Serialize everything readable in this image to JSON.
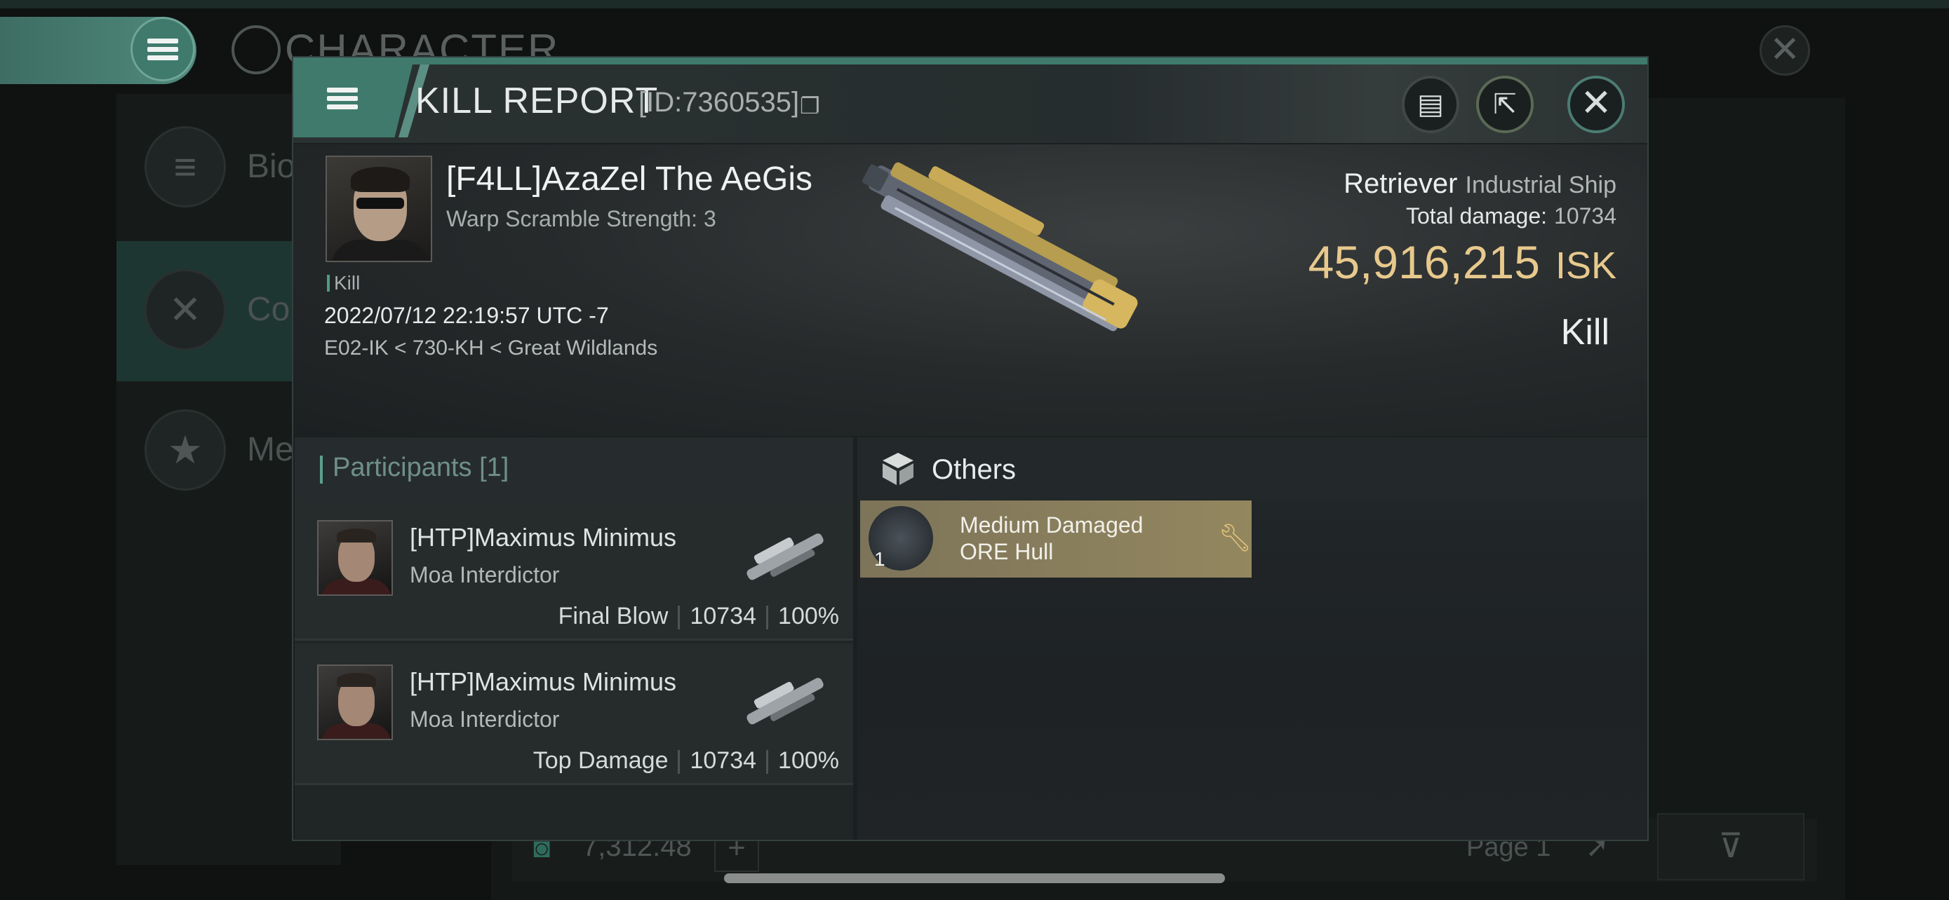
{
  "background": {
    "title": "CHARACTER",
    "nav": [
      {
        "label": "Bio"
      },
      {
        "label": "Co"
      },
      {
        "label": "Me"
      }
    ],
    "credits": "7,312.48",
    "page": "Page 1"
  },
  "modal": {
    "title": "KILL REPORT",
    "report_id": "[ID:7360535]",
    "victim": {
      "name": "[F4LL]AzaZel The AeGis",
      "warp": "Warp Scramble Strength: 3",
      "tag": "Kill",
      "time": "2022/07/12 22:19:57 UTC -7",
      "location": "E02-IK < 730-KH < Great Wildlands"
    },
    "ship": {
      "name": "Retriever",
      "class": "Industrial Ship",
      "total_damage_label": "Total damage:",
      "total_damage": "10734",
      "isk_value": "45,916,215",
      "isk_unit": "ISK",
      "result": "Kill"
    },
    "participants": {
      "title": "Participants [1]",
      "rows": [
        {
          "name": "[HTP]Maximus Minimus",
          "ship": "Moa Interdictor",
          "role": "Final Blow",
          "damage": "10734",
          "percent": "100%"
        },
        {
          "name": "[HTP]Maximus Minimus",
          "ship": "Moa Interdictor",
          "role": "Top Damage",
          "damage": "10734",
          "percent": "100%"
        }
      ]
    },
    "others": {
      "title": "Others",
      "items": [
        {
          "name_line1": "Medium Damaged",
          "name_line2": "ORE Hull",
          "qty": "1"
        }
      ]
    }
  },
  "colors": {
    "accent": "#3f7a6d",
    "isk": "#e8c98d",
    "item_card": "#8a7f5c"
  },
  "icons": [
    "menu-icon",
    "copy-icon",
    "document-icon",
    "share-icon",
    "close-icon",
    "cube-icon",
    "wrench-icon"
  ]
}
